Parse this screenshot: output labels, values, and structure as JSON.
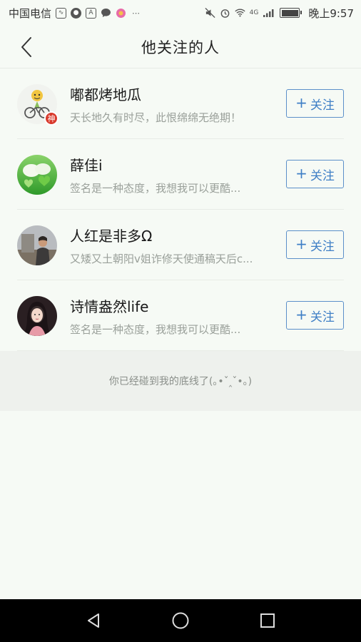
{
  "status_bar": {
    "carrier": "中国电信",
    "time": "晚上9:57",
    "network": "4G",
    "colors": {
      "icons": "#555555"
    }
  },
  "header": {
    "title": "他关注的人"
  },
  "follow_button_label": "+ 关注",
  "follow_button_parts": {
    "plus": "+",
    "text": "关注"
  },
  "users": [
    {
      "name": "嘟都烤地瓜",
      "signature": "天长地久有时尽，此恨绵绵无绝期！",
      "badge": "神"
    },
    {
      "name": "薛佳i",
      "signature": "签名是一种态度，我想我可以更酷..."
    },
    {
      "name": "人红是非多Ω",
      "signature": "又矮又土朝阳v姐诈修天使通稿天后c..."
    },
    {
      "name": "诗情盎然life",
      "signature": "签名是一种态度，我想我可以更酷..."
    }
  ],
  "end_notice": "你已经碰到我的底线了(｡•ˇ‸ˇ•｡)",
  "colors": {
    "accent": "#3f7fc6",
    "background": "#f6faf5",
    "badge": "#d8392b"
  }
}
